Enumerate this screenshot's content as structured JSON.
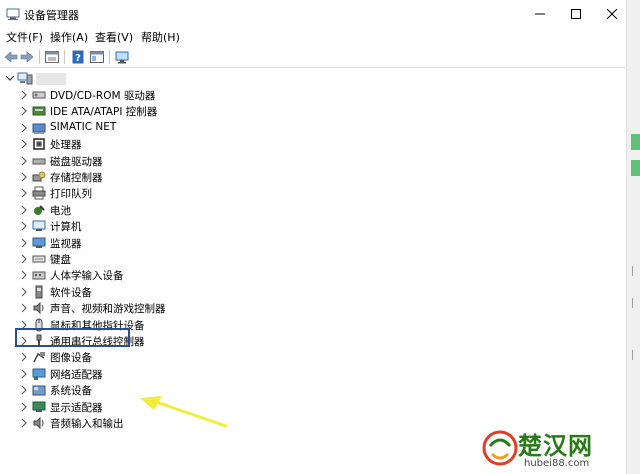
{
  "window": {
    "title": "设备管理器"
  },
  "menu": [
    "文件(F)",
    "操作(A)",
    "查看(V)",
    "帮助(H)"
  ],
  "toolbar": {
    "buttons": [
      "back-icon",
      "forward-icon",
      "properties-icon",
      "help-icon",
      "view-icon",
      "monitor-icon"
    ]
  },
  "tree": {
    "items": [
      "DVD/CD-ROM 驱动器",
      "IDE ATA/ATAPI 控制器",
      "SIMATIC NET",
      "处理器",
      "磁盘驱动器",
      "存储控制器",
      "打印队列",
      "电池",
      "计算机",
      "监视器",
      "键盘",
      "人体学输入设备",
      "软件设备",
      "声音、视频和游戏控制器",
      "鼠标和其他指针设备",
      "通用串行总线控制器",
      "图像设备",
      "网络适配器",
      "系统设备",
      "显示适配器",
      "音频输入和输出"
    ],
    "highlighted": "显示适配器"
  },
  "watermark": {
    "title": "楚汉网",
    "url": "hubei88.com"
  },
  "colors": {
    "highlight_border": "#2b4f8a",
    "arrow": "#f2ec3a",
    "watermark_text": "#2a7a1a"
  }
}
